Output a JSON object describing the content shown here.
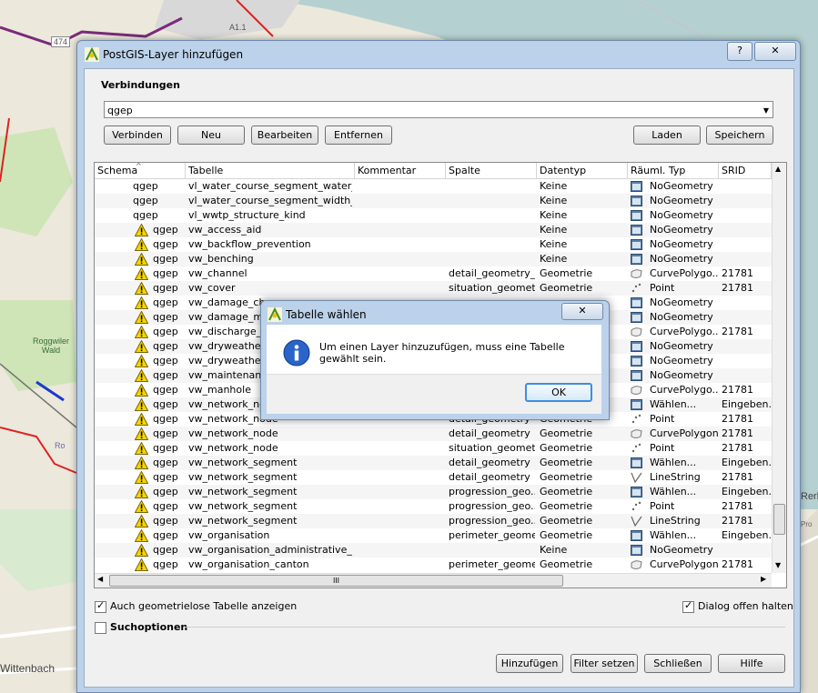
{
  "map": {
    "labels": [
      "474",
      "A1.1",
      "Roggwiler Wald",
      "Rog",
      "Wittenbach",
      "Ro",
      "Rerb",
      "Pro"
    ]
  },
  "dialog": {
    "title": "PostGIS-Layer hinzufügen",
    "help_label": "?",
    "connections_label": "Verbindungen",
    "connection_value": "qgep",
    "buttons": {
      "connect": "Verbinden",
      "new": "Neu",
      "edit": "Bearbeiten",
      "remove": "Entfernen",
      "load": "Laden",
      "save": "Speichern"
    },
    "columns": [
      "Schema",
      "Tabelle",
      "Kommentar",
      "Spalte",
      "Datentyp",
      "Räuml. Typ",
      "SRID"
    ],
    "rows": [
      {
        "schema": "qgep",
        "table": "vl_water_course_segment_water_...",
        "column": "",
        "type": "Keine",
        "spatial": "NoGeometry",
        "srid": "",
        "warn": false,
        "icon": "nogeom"
      },
      {
        "schema": "qgep",
        "table": "vl_water_course_segment_width_...",
        "column": "",
        "type": "Keine",
        "spatial": "NoGeometry",
        "srid": "",
        "warn": false,
        "icon": "nogeom"
      },
      {
        "schema": "qgep",
        "table": "vl_wwtp_structure_kind",
        "column": "",
        "type": "Keine",
        "spatial": "NoGeometry",
        "srid": "",
        "warn": false,
        "icon": "nogeom"
      },
      {
        "schema": "qgep",
        "table": "vw_access_aid",
        "column": "",
        "type": "Keine",
        "spatial": "NoGeometry",
        "srid": "",
        "warn": true,
        "icon": "nogeom"
      },
      {
        "schema": "qgep",
        "table": "vw_backflow_prevention",
        "column": "",
        "type": "Keine",
        "spatial": "NoGeometry",
        "srid": "",
        "warn": true,
        "icon": "nogeom"
      },
      {
        "schema": "qgep",
        "table": "vw_benching",
        "column": "",
        "type": "Keine",
        "spatial": "NoGeometry",
        "srid": "",
        "warn": true,
        "icon": "nogeom"
      },
      {
        "schema": "qgep",
        "table": "vw_channel",
        "column": "detail_geometry_...",
        "type": "Geometrie",
        "spatial": "CurvePolygo...",
        "srid": "21781",
        "warn": true,
        "icon": "polygon"
      },
      {
        "schema": "qgep",
        "table": "vw_cover",
        "column": "situation_geometry",
        "type": "Geometrie",
        "spatial": "Point",
        "srid": "21781",
        "warn": true,
        "icon": "point"
      },
      {
        "schema": "qgep",
        "table": "vw_damage_cha",
        "column": "",
        "type": "",
        "spatial": "NoGeometry",
        "srid": "",
        "warn": true,
        "icon": "nogeom"
      },
      {
        "schema": "qgep",
        "table": "vw_damage_ma",
        "column": "",
        "type": "",
        "spatial": "NoGeometry",
        "srid": "",
        "warn": true,
        "icon": "nogeom"
      },
      {
        "schema": "qgep",
        "table": "vw_discharge_p",
        "column": "",
        "type": "",
        "spatial": "CurvePolygo...",
        "srid": "21781",
        "warn": true,
        "icon": "polygon"
      },
      {
        "schema": "qgep",
        "table": "vw_dryweather_",
        "column": "",
        "type": "",
        "spatial": "NoGeometry",
        "srid": "",
        "warn": true,
        "icon": "nogeom"
      },
      {
        "schema": "qgep",
        "table": "vw_dryweather_",
        "column": "",
        "type": "",
        "spatial": "NoGeometry",
        "srid": "",
        "warn": true,
        "icon": "nogeom"
      },
      {
        "schema": "qgep",
        "table": "vw_maintenance",
        "column": "",
        "type": "",
        "spatial": "NoGeometry",
        "srid": "",
        "warn": true,
        "icon": "nogeom"
      },
      {
        "schema": "qgep",
        "table": "vw_manhole",
        "column": "",
        "type": "",
        "spatial": "CurvePolygo...",
        "srid": "21781",
        "warn": true,
        "icon": "polygon"
      },
      {
        "schema": "qgep",
        "table": "vw_network_noc",
        "column": "",
        "type": "",
        "spatial": "Wählen...",
        "srid": "Eingeben...",
        "warn": true,
        "icon": "nogeom"
      },
      {
        "schema": "qgep",
        "table": "vw_network_node",
        "column": "detail_geometry",
        "type": "Geometrie",
        "spatial": "Point",
        "srid": "21781",
        "warn": true,
        "icon": "point"
      },
      {
        "schema": "qgep",
        "table": "vw_network_node",
        "column": "detail_geometry",
        "type": "Geometrie",
        "spatial": "CurvePolygon",
        "srid": "21781",
        "warn": true,
        "icon": "polygon"
      },
      {
        "schema": "qgep",
        "table": "vw_network_node",
        "column": "situation_geometry",
        "type": "Geometrie",
        "spatial": "Point",
        "srid": "21781",
        "warn": true,
        "icon": "point"
      },
      {
        "schema": "qgep",
        "table": "vw_network_segment",
        "column": "detail_geometry",
        "type": "Geometrie",
        "spatial": "Wählen...",
        "srid": "Eingeben...",
        "warn": true,
        "icon": "nogeom"
      },
      {
        "schema": "qgep",
        "table": "vw_network_segment",
        "column": "detail_geometry",
        "type": "Geometrie",
        "spatial": "LineString",
        "srid": "21781",
        "warn": true,
        "icon": "line"
      },
      {
        "schema": "qgep",
        "table": "vw_network_segment",
        "column": "progression_geo...",
        "type": "Geometrie",
        "spatial": "Wählen...",
        "srid": "Eingeben...",
        "warn": true,
        "icon": "nogeom"
      },
      {
        "schema": "qgep",
        "table": "vw_network_segment",
        "column": "progression_geo...",
        "type": "Geometrie",
        "spatial": "Point",
        "srid": "21781",
        "warn": true,
        "icon": "point"
      },
      {
        "schema": "qgep",
        "table": "vw_network_segment",
        "column": "progression_geo...",
        "type": "Geometrie",
        "spatial": "LineString",
        "srid": "21781",
        "warn": true,
        "icon": "line"
      },
      {
        "schema": "qgep",
        "table": "vw_organisation",
        "column": "perimeter_geome...",
        "type": "Geometrie",
        "spatial": "Wählen...",
        "srid": "Eingeben...",
        "warn": true,
        "icon": "nogeom"
      },
      {
        "schema": "qgep",
        "table": "vw_organisation_administrative_of...",
        "column": "",
        "type": "Keine",
        "spatial": "NoGeometry",
        "srid": "",
        "warn": true,
        "icon": "nogeom"
      },
      {
        "schema": "qgep",
        "table": "vw_organisation_canton",
        "column": "perimeter_geome...",
        "type": "Geometrie",
        "spatial": "CurvePolygon",
        "srid": "21781",
        "warn": true,
        "icon": "polygon"
      }
    ],
    "hscroll_grip": "III",
    "show_geometryless_label": "Auch geometrielose Tabelle anzeigen",
    "keep_dialog_open_label": "Dialog offen halten",
    "search_options_label": "Suchoptionen",
    "bottom_buttons": {
      "add": "Hinzufügen",
      "filter": "Filter setzen",
      "close": "Schließen",
      "help": "Hilfe"
    }
  },
  "message_box": {
    "title": "Tabelle wählen",
    "message": "Um einen Layer hinzuzufügen, muss eine Tabelle gewählt sein.",
    "ok_label": "OK",
    "close_label": "✕"
  }
}
